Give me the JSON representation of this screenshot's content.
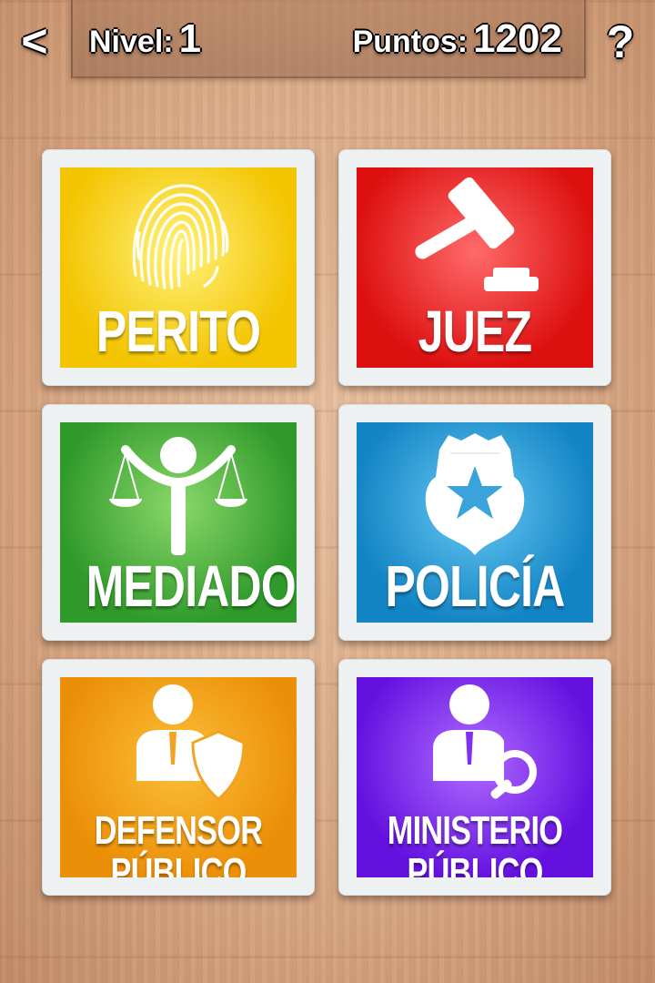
{
  "header": {
    "back_label": "<",
    "level_label": "Nivel:",
    "level_value": "1",
    "points_label": "Puntos:",
    "points_value": "1202",
    "help_label": "?"
  },
  "cards": [
    {
      "label_lines": [
        "PERITO"
      ],
      "icon": "fingerprint-icon",
      "color_inner": "#fff27a",
      "color_outer": "#f3c400"
    },
    {
      "label_lines": [
        "JUEZ"
      ],
      "icon": "gavel-icon",
      "color_inner": "#ff6a6a",
      "color_outer": "#dd1010"
    },
    {
      "label_lines": [
        "MEDIADOR"
      ],
      "icon": "scales-person-icon",
      "color_inner": "#8bd86a",
      "color_outer": "#2f9a2a"
    },
    {
      "label_lines": [
        "POLICÍA"
      ],
      "icon": "police-badge-icon",
      "color_inner": "#68c9f4",
      "color_outer": "#1384c4"
    },
    {
      "label_lines": [
        "DEFENSOR",
        "PÚBLICO"
      ],
      "icon": "defender-shield-icon",
      "color_inner": "#fbc03a",
      "color_outer": "#ec8f08"
    },
    {
      "label_lines": [
        "MINISTERIO",
        "PÚBLICO"
      ],
      "icon": "prosecutor-magnifier-icon",
      "color_inner": "#b06cff",
      "color_outer": "#6411e0"
    }
  ]
}
